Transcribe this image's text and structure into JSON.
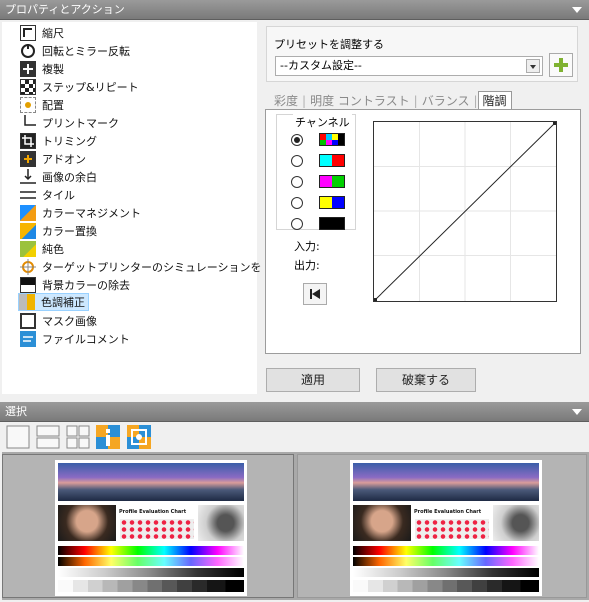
{
  "top_panel": {
    "title": "プロパティとアクション"
  },
  "actions": [
    {
      "label": "縮尺",
      "icon": "scale-icon"
    },
    {
      "label": "回転とミラー反転",
      "icon": "rotate-icon"
    },
    {
      "label": "複製",
      "icon": "duplicate-icon"
    },
    {
      "label": "ステップ&リピート",
      "icon": "step-repeat-icon"
    },
    {
      "label": "配置",
      "icon": "placement-icon"
    },
    {
      "label": "プリントマーク",
      "icon": "print-marks-icon"
    },
    {
      "label": "トリミング",
      "icon": "crop-icon"
    },
    {
      "label": "アドオン",
      "icon": "addon-icon"
    },
    {
      "label": "画像の余白",
      "icon": "margin-icon"
    },
    {
      "label": "タイル",
      "icon": "tile-icon"
    },
    {
      "label": "カラーマネジメント",
      "icon": "color-management-icon"
    },
    {
      "label": "カラー置換",
      "icon": "color-replace-icon"
    },
    {
      "label": "純色",
      "icon": "spot-color-icon"
    },
    {
      "label": "ターゲットプリンターのシミュレーションをする",
      "icon": "target-printer-icon"
    },
    {
      "label": "背景カラーの除去",
      "icon": "remove-background-icon"
    },
    {
      "label": "色調補正",
      "icon": "color-adjust-icon"
    },
    {
      "label": "マスク画像",
      "icon": "mask-image-icon"
    },
    {
      "label": "ファイルコメント",
      "icon": "file-comment-icon"
    }
  ],
  "preset": {
    "label": "プリセットを調整する",
    "value": "--カスタム設定--"
  },
  "tabs": [
    {
      "label": "彩度",
      "active": false
    },
    {
      "label": "明度 コントラスト",
      "active": false
    },
    {
      "label": "バランス",
      "active": false
    },
    {
      "label": "階調",
      "active": true
    }
  ],
  "channel": {
    "title": "チャンネル",
    "options": [
      {
        "colors": [
          "#ff0000",
          "#00c8ff",
          "#ffff00",
          "#000000",
          "#00c000",
          "#ff00ff",
          "#0000ff",
          "#000000"
        ],
        "checked": true
      },
      {
        "colors": [
          "#00ffff",
          "#ff0000"
        ],
        "checked": false
      },
      {
        "colors": [
          "#ff00ff",
          "#00d000"
        ],
        "checked": false
      },
      {
        "colors": [
          "#ffff00",
          "#0000ff"
        ],
        "checked": false
      },
      {
        "colors": [
          "#000000"
        ],
        "checked": false
      }
    ]
  },
  "input_label": "入力:",
  "output_label": "出力:",
  "buttons": {
    "apply": "適用",
    "discard": "破棄する"
  },
  "bottom_panel": {
    "title": "選択"
  },
  "thumbnails": [
    {
      "caption": "Profile Evaluation Chart"
    },
    {
      "caption": "Profile Evaluation Chart"
    }
  ]
}
